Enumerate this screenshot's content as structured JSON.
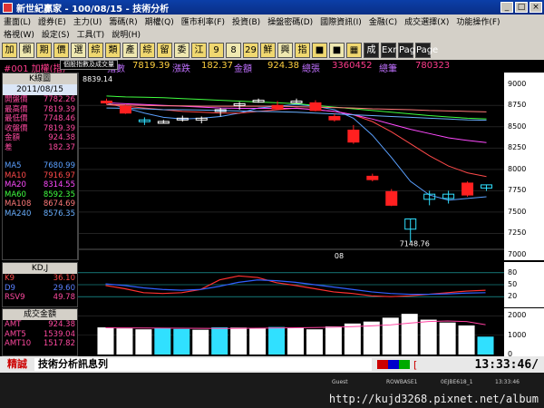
{
  "window": {
    "title": "新世紀贏家 - 100/08/15 - 技術分析"
  },
  "menu": {
    "row1": [
      "畫面(L)",
      "證券(E)",
      "主力(U)",
      "籌碼(R)",
      "期權(Q)",
      "匯市利率(F)",
      "投資(B)",
      "操盤密碼(D)",
      "國際資訊(I)",
      "金融(C)",
      "成交選擇(X)",
      "功能操作(F)"
    ],
    "row2": [
      "格視(W)",
      "設定(S)",
      "工具(T)",
      "說明(H)"
    ]
  },
  "toolbar": [
    "加",
    "欄",
    "期",
    "價",
    "選",
    "綜",
    "類",
    "產",
    "綜",
    "留",
    "委",
    "江",
    "9",
    "8",
    "29",
    "鮮",
    "興",
    "指",
    "■",
    "■",
    "▦",
    "成",
    "Exr",
    "Page",
    "Page"
  ],
  "tooltip": "個股指數及成交量",
  "quote": {
    "code": "#001 加權(指)",
    "label1": "指數",
    "value1": "7819.39",
    "label2": "漲跌",
    "value2": "182.37",
    "label3": "金額",
    "value3": "924.38",
    "label4": "總張",
    "value4": "3360452",
    "label5": "總筆",
    "value5": "780323"
  },
  "left_panel": {
    "title": "K線圖",
    "date": "2011/08/15",
    "rows": [
      {
        "label": "開盤價",
        "value": "7782.26",
        "color": "#ff4aa0"
      },
      {
        "label": "最高價",
        "value": "7819.39",
        "color": "#ff4aa0"
      },
      {
        "label": "最低價",
        "value": "7748.46",
        "color": "#ff4aa0"
      },
      {
        "label": "收盤價",
        "value": "7819.39",
        "color": "#ff4aa0"
      },
      {
        "label": "金額",
        "value": "924.38",
        "color": "#ff4aa0"
      },
      {
        "label": "差",
        "value": "182.37",
        "color": "#ff4aa0"
      }
    ],
    "ma_rows": [
      {
        "label": "MA5",
        "value": "7680.99",
        "color": "#5aa0ff"
      },
      {
        "label": "MA10",
        "value": "7916.97",
        "color": "#ff4a4a"
      },
      {
        "label": "MA20",
        "value": "8314.55",
        "color": "#ff4aff"
      },
      {
        "label": "MA60",
        "value": "8592.35",
        "color": "#40ff40"
      },
      {
        "label": "MA108",
        "value": "8674.69",
        "color": "#ff7a7a"
      },
      {
        "label": "MA240",
        "value": "8576.35",
        "color": "#6ab0ff"
      }
    ]
  },
  "price_axis": [
    "9000",
    "8750",
    "8500",
    "8250",
    "8000",
    "7750",
    "7500",
    "7250",
    "7000"
  ],
  "chart_texts": {
    "top_value": "8839.14",
    "low_value": "7148.76",
    "x_tick": "08"
  },
  "kd_panel": {
    "title": "KD,J",
    "rows": [
      {
        "label": "K9",
        "value": "36.10",
        "color": "#ff4a4a"
      },
      {
        "label": "D9",
        "value": "29.60",
        "color": "#5a80ff"
      },
      {
        "label": "RSV9",
        "value": "49.78",
        "color": "#ff4aa0"
      }
    ],
    "axis": [
      "80",
      "50",
      "20"
    ]
  },
  "vol_panel": {
    "title": "成交金額",
    "rows": [
      {
        "label": "AMT",
        "value": "924.38",
        "color": "#ff4aa0"
      },
      {
        "label": "AMT5",
        "value": "1539.04",
        "color": "#ff4aa0"
      },
      {
        "label": "AMT10",
        "value": "1517.82",
        "color": "#ff4aa0"
      }
    ],
    "axis": [
      "2000",
      "1000",
      "0"
    ]
  },
  "status": {
    "jing": "精誠",
    "message": "技術分析訊息列",
    "bracket": "[",
    "time": "13:33:46/"
  },
  "footer": {
    "guest": "Guest",
    "server": "ROWBASE1",
    "node": "0EJBE618_1",
    "clock": "13:33:46",
    "watermark": "http://kujd3268.pixnet.net/album"
  },
  "chart_data": {
    "type": "candlestick",
    "candles": [
      {
        "o": 8800,
        "h": 8830,
        "l": 8760,
        "c": 8780,
        "color": "red"
      },
      {
        "o": 8740,
        "h": 8760,
        "l": 8650,
        "c": 8660,
        "color": "red"
      },
      {
        "o": 8560,
        "h": 8610,
        "l": 8520,
        "c": 8580,
        "color": "cyan"
      },
      {
        "o": 8560,
        "h": 8580,
        "l": 8540,
        "c": 8562,
        "color": "white"
      },
      {
        "o": 8600,
        "h": 8630,
        "l": 8560,
        "c": 8580,
        "color": "white"
      },
      {
        "o": 8590,
        "h": 8620,
        "l": 8540,
        "c": 8600,
        "color": "white"
      },
      {
        "o": 8680,
        "h": 8720,
        "l": 8620,
        "c": 8700,
        "color": "white"
      },
      {
        "o": 8760,
        "h": 8790,
        "l": 8700,
        "c": 8770,
        "color": "white"
      },
      {
        "o": 8800,
        "h": 8830,
        "l": 8780,
        "c": 8810,
        "color": "white"
      },
      {
        "o": 8750,
        "h": 8800,
        "l": 8700,
        "c": 8710,
        "color": "red"
      },
      {
        "o": 8800,
        "h": 8830,
        "l": 8780,
        "c": 8800,
        "color": "white"
      },
      {
        "o": 8780,
        "h": 8810,
        "l": 8680,
        "c": 8690,
        "color": "red"
      },
      {
        "o": 8620,
        "h": 8650,
        "l": 8560,
        "c": 8580,
        "color": "red"
      },
      {
        "o": 8460,
        "h": 8520,
        "l": 8300,
        "c": 8320,
        "color": "red"
      },
      {
        "o": 7920,
        "h": 7950,
        "l": 7860,
        "c": 7880,
        "color": "red"
      },
      {
        "o": 7740,
        "h": 7770,
        "l": 7570,
        "c": 7580,
        "color": "red"
      },
      {
        "o": 7300,
        "h": 7420,
        "l": 7148,
        "c": 7420,
        "color": "cyan"
      },
      {
        "o": 7650,
        "h": 7750,
        "l": 7580,
        "c": 7710,
        "color": "cyan"
      },
      {
        "o": 7710,
        "h": 7750,
        "l": 7600,
        "c": 7660,
        "color": "cyan"
      },
      {
        "o": 7840,
        "h": 7860,
        "l": 7680,
        "c": 7700,
        "color": "red"
      },
      {
        "o": 7782,
        "h": 7819,
        "l": 7748,
        "c": 7819,
        "color": "cyan"
      }
    ],
    "ma_lines": [
      {
        "name": "MA5",
        "color": "#5aa0ff",
        "values": [
          8780,
          8720,
          8660,
          8610,
          8590,
          8600,
          8620,
          8660,
          8720,
          8740,
          8760,
          8740,
          8700,
          8600,
          8400,
          8140,
          7860,
          7700,
          7640,
          7660,
          7680
        ]
      },
      {
        "name": "MA10",
        "color": "#ff4a4a",
        "values": [
          8760,
          8740,
          8720,
          8700,
          8680,
          8670,
          8660,
          8660,
          8680,
          8700,
          8720,
          8700,
          8680,
          8640,
          8560,
          8440,
          8300,
          8160,
          8040,
          7960,
          7916
        ]
      },
      {
        "name": "MA20",
        "color": "#ff4aff",
        "values": [
          8780,
          8770,
          8760,
          8750,
          8740,
          8730,
          8720,
          8715,
          8715,
          8715,
          8715,
          8700,
          8680,
          8640,
          8590,
          8530,
          8470,
          8420,
          8370,
          8340,
          8314
        ]
      },
      {
        "name": "MA60",
        "color": "#40ff40",
        "values": [
          8860,
          8850,
          8845,
          8840,
          8830,
          8820,
          8810,
          8800,
          8790,
          8780,
          8770,
          8750,
          8730,
          8710,
          8690,
          8670,
          8650,
          8630,
          8615,
          8600,
          8592
        ]
      },
      {
        "name": "MA108",
        "color": "#ff7a7a",
        "values": [
          8760,
          8755,
          8750,
          8745,
          8745,
          8740,
          8740,
          8740,
          8740,
          8740,
          8735,
          8730,
          8725,
          8720,
          8710,
          8705,
          8700,
          8690,
          8685,
          8680,
          8674
        ]
      },
      {
        "name": "MA240",
        "color": "#6ab0ff",
        "values": [
          8720,
          8715,
          8710,
          8700,
          8700,
          8695,
          8690,
          8685,
          8680,
          8675,
          8670,
          8660,
          8650,
          8640,
          8630,
          8620,
          8610,
          8600,
          8590,
          8580,
          8576
        ]
      }
    ],
    "ylim": [
      7000,
      9050
    ],
    "kd": {
      "K": [
        48,
        40,
        30,
        28,
        30,
        38,
        62,
        72,
        68,
        55,
        48,
        40,
        32,
        28,
        22,
        20,
        22,
        26,
        30,
        34,
        36
      ],
      "D": [
        52,
        48,
        42,
        38,
        36,
        38,
        46,
        56,
        62,
        60,
        56,
        50,
        44,
        38,
        32,
        28,
        26,
        26,
        27,
        29,
        30
      ],
      "ylim": [
        0,
        100
      ]
    },
    "volume": {
      "values": [
        1400,
        1350,
        1300,
        1380,
        1320,
        1280,
        1400,
        1390,
        1350,
        1420,
        1380,
        1300,
        1450,
        1600,
        1700,
        1900,
        2100,
        1800,
        1650,
        1500,
        924
      ],
      "colors": [
        "white",
        "white",
        "white",
        "cyan",
        "cyan",
        "white",
        "cyan",
        "white",
        "white",
        "cyan",
        "white",
        "white",
        "white",
        "white",
        "white",
        "white",
        "white",
        "white",
        "white",
        "white",
        "cyan"
      ],
      "ma5": [
        1380,
        1375,
        1370,
        1365,
        1360,
        1350,
        1345,
        1350,
        1360,
        1370,
        1380,
        1390,
        1410,
        1440,
        1480,
        1530,
        1620,
        1700,
        1730,
        1700,
        1539
      ],
      "ylim": [
        0,
        2200
      ]
    }
  }
}
